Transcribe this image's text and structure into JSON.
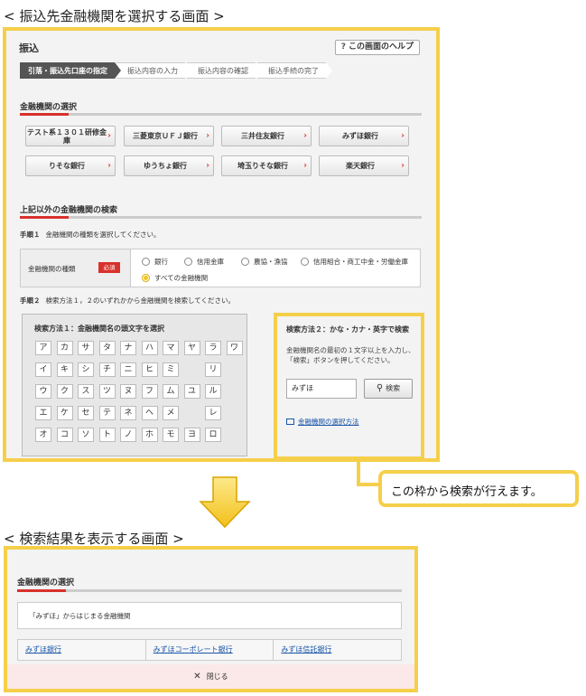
{
  "headings": {
    "top": "< 振込先金融機関を選択する画面 >",
    "bottom": "< 検索結果を表示する画面 >"
  },
  "top_panel": {
    "title": "振込",
    "help_button": "この画面のヘルプ",
    "steps": [
      "引落・振込先口座の指定",
      "振込内容の入力",
      "振込内容の確認",
      "振込手続の完了"
    ],
    "bank_section_title": "金融機関の選択",
    "banks": [
      "テスト系１３０１研修金庫",
      "三菱東京ＵＦＪ銀行",
      "三井住友銀行",
      "みずほ銀行",
      "りそな銀行",
      "ゆうちょ銀行",
      "埼玉りそな銀行",
      "楽天銀行"
    ],
    "search_section_title": "上記以外の金融機関の検索",
    "step1_label": "手順１",
    "step1_text": "金融機関の種類を選択してください。",
    "type_label": "金融機関の種類",
    "required_badge": "必須",
    "radio_options": [
      "銀行",
      "信用金庫",
      "農協・漁協",
      "信用組合・商工中金・労働金庫",
      "すべての金融機関"
    ],
    "radio_selected": "すべての金融機関",
    "step2_label": "手順２",
    "step2_text": "検索方法１，２のいずれかから金融機関を検索してください。",
    "method1_title": "検索方法１：金融機関名の頭文字を選択",
    "kana_rows": [
      [
        "ア",
        "カ",
        "サ",
        "タ",
        "ナ",
        "ハ",
        "マ",
        "ヤ",
        "ラ",
        "ワ"
      ],
      [
        "イ",
        "キ",
        "シ",
        "チ",
        "ニ",
        "ヒ",
        "ミ",
        "",
        "リ",
        ""
      ],
      [
        "ウ",
        "ク",
        "ス",
        "ツ",
        "ヌ",
        "フ",
        "ム",
        "ユ",
        "ル",
        ""
      ],
      [
        "エ",
        "ケ",
        "セ",
        "テ",
        "ネ",
        "ヘ",
        "メ",
        "",
        "レ",
        ""
      ],
      [
        "オ",
        "コ",
        "ソ",
        "ト",
        "ノ",
        "ホ",
        "モ",
        "ヨ",
        "ロ",
        ""
      ]
    ],
    "method2_title": "検索方法２：かな・カナ・英字で検索",
    "method2_desc_1": "金融機関名の最初の１文字以上を入力し、",
    "method2_desc_2": "「検索」ボタンを押してください。",
    "search_input_value": "みずほ",
    "search_button": "検索",
    "help_link": "金融機関の選択方法"
  },
  "callout": "この枠から検索が行えます。",
  "bottom_panel": {
    "title": "金融機関の選択",
    "result_text": "「みずほ」からはじまる金融機関",
    "results": [
      "みずほ銀行",
      "みずほコーポレート銀行",
      "みずほ信託銀行"
    ],
    "close_button": "閉じる"
  },
  "colors": {
    "accent_yellow": "#f5cf4a",
    "accent_red": "#d9312b",
    "link_blue": "#1a56a8"
  }
}
